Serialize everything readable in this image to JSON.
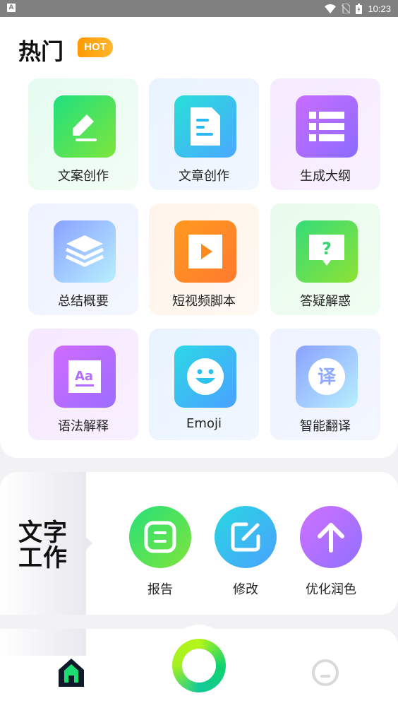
{
  "status_bar": {
    "time": "10:23",
    "left_icon": "A"
  },
  "hot": {
    "title": "热门",
    "badge": "HOT",
    "items": [
      {
        "label": "文案创作",
        "icon": "pencil-icon"
      },
      {
        "label": "文章创作",
        "icon": "document-icon"
      },
      {
        "label": "生成大纲",
        "icon": "outline-list-icon"
      },
      {
        "label": "总结概要",
        "icon": "layers-icon"
      },
      {
        "label": "短视频脚本",
        "icon": "play-video-icon"
      },
      {
        "label": "答疑解惑",
        "icon": "question-bubble-icon"
      },
      {
        "label": "语法解释",
        "icon": "grammar-aa-icon"
      },
      {
        "label": "Emoji",
        "icon": "smiley-icon"
      },
      {
        "label": "智能翻译",
        "icon": "translate-icon",
        "glyph": "译"
      }
    ]
  },
  "work": {
    "title_line1": "文字",
    "title_line2": "工作",
    "items": [
      {
        "label": "报告",
        "icon": "report-icon"
      },
      {
        "label": "修改",
        "icon": "edit-icon"
      },
      {
        "label": "优化润色",
        "icon": "arrow-up-icon"
      }
    ]
  },
  "bottom_nav": {
    "items": [
      {
        "name": "home",
        "icon": "home-icon"
      },
      {
        "name": "center",
        "icon": "ring-icon"
      },
      {
        "name": "profile",
        "icon": "profile-icon"
      }
    ]
  }
}
